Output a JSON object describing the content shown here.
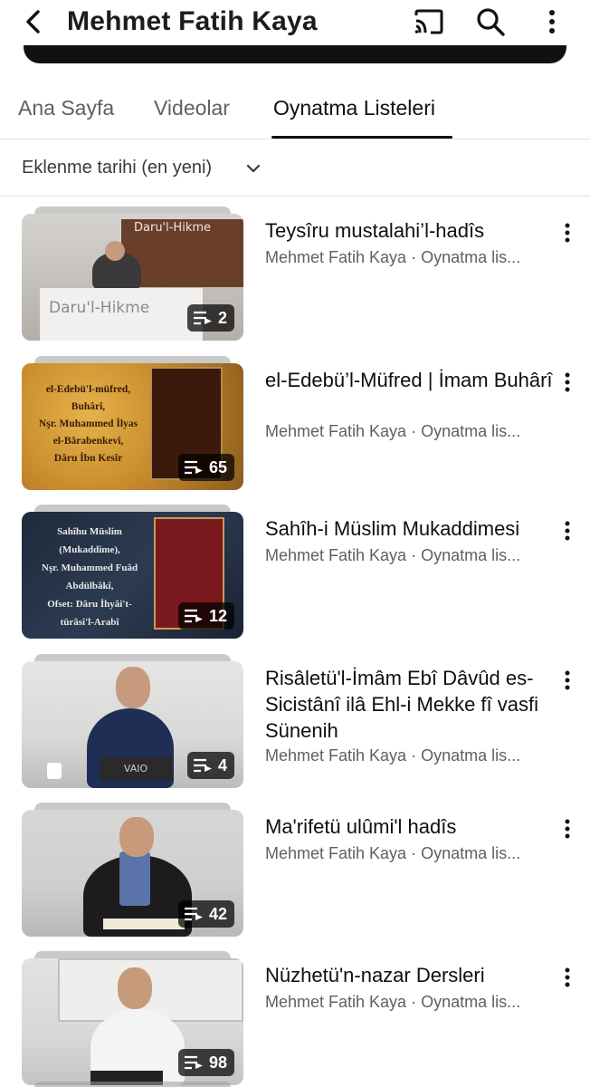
{
  "header": {
    "title": "Mehmet Fatih Kaya",
    "back_icon": "chevron-left-icon",
    "cast_icon": "cast-icon",
    "search_icon": "search-icon",
    "more_icon": "more-vertical-icon"
  },
  "tabs": [
    {
      "label": "Ana Sayfa",
      "active": false
    },
    {
      "label": "Videolar",
      "active": false
    },
    {
      "label": "Oynatma Listeleri",
      "active": true
    }
  ],
  "sort": {
    "label": "Eklenme tarihi (en yeni)",
    "icon": "chevron-down-icon"
  },
  "playlists": [
    {
      "title": "Teysîru mustalahi’l-hadîs",
      "subtitle": "Mehmet Fatih Kaya · Oynatma lis...",
      "count": "2",
      "thumb_logo": "Daru'l-Hikme",
      "thumb_logo2": "Daru'l-Hikme"
    },
    {
      "title": "el-Edebü’l-Müfred | İmam Buhârî",
      "subtitle": "Mehmet Fatih Kaya · Oynatma lis...",
      "count": "65",
      "thumb_text": [
        "el-Edebü'l-müfred,",
        "Buhârî,",
        "Nşr. Muhammed İlyas",
        "el-Bârabenkevî,",
        "Dâru İbn Kesîr"
      ]
    },
    {
      "title": "Sahîh-i Müslim Mukaddimesi",
      "subtitle": "Mehmet Fatih Kaya · Oynatma lis...",
      "count": "12",
      "thumb_text": [
        "Sahîhu Müslim",
        "(Mukaddime),",
        "Nşr. Muhammed Fuâd",
        "Abdülbâkî,",
        "Ofset: Dâru İhyâi't-",
        "türâsi'l-Arabî"
      ]
    },
    {
      "title": "Risâletü'l-İmâm Ebî Dâvûd es-Sicistânî ilâ Ehl-i Mekke fî vasfi Sünenih",
      "subtitle": "Mehmet Fatih Kaya · Oynatma lis...",
      "count": "4",
      "thumb_laptop": "VAIO"
    },
    {
      "title": "Ma'rifetü ulûmi'l hadîs",
      "subtitle": "Mehmet Fatih Kaya · Oynatma lis...",
      "count": "42"
    },
    {
      "title": "Nüzhetü'n-nazar Dersleri",
      "subtitle": "Mehmet Fatih Kaya · Oynatma lis...",
      "count": "98"
    }
  ],
  "playlist_badge_icon": "playlist-icon",
  "item_more_icon": "more-vertical-icon"
}
